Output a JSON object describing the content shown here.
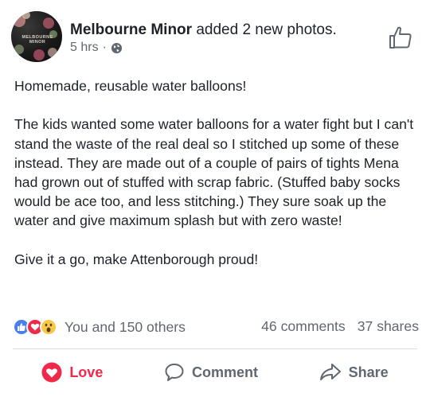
{
  "post": {
    "author": "Melbourne Minor",
    "action": " added 2 new photos.",
    "time": "5 hrs",
    "separator": "·",
    "avatar_text": "MELBOURNE MINOR",
    "privacy_icon": "globe-icon",
    "paragraphs": [
      "Homemade, reusable water balloons!",
      "The kids wanted some water balloons for a water fight but I can't stand the waste of the real deal so I stitched up some of these instead. They are made out of a couple of pairs of tights Mena had grown out of stuffed with scrap fabric. (Stuffed baby socks would be ace too, and less stitching.) They sure soak up the water and give maximum splash but with zero waste!",
      "Give it a go, make Attenborough proud!"
    ]
  },
  "reactions": {
    "summary": "You and 150 others",
    "comments": "46 comments",
    "shares": "37 shares",
    "icons": [
      "like-icon",
      "love-icon",
      "wow-icon"
    ]
  },
  "actions": {
    "love_label": "Love",
    "comment_label": "Comment",
    "share_label": "Share"
  },
  "colors": {
    "love": "#f0284a",
    "like": "#4a7ff0",
    "muted": "#616770",
    "text": "#1d2129"
  }
}
